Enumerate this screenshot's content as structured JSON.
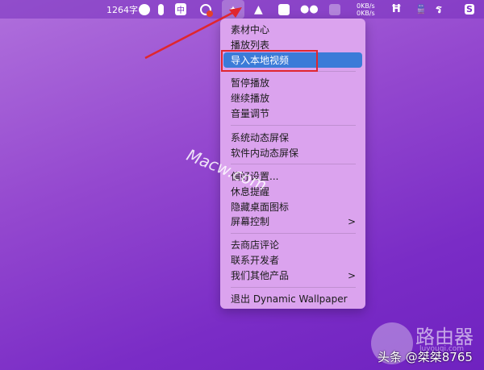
{
  "menubar": {
    "word_count": "1264字",
    "ime": "中",
    "net_up": "0KB/s",
    "net_down": "0KB/s",
    "icons": [
      "smiley-icon",
      "microphone-icon",
      "ime-icon",
      "creative-cloud-icon",
      "dynamic-wallpaper-icon",
      "dog-icon",
      "bookmark-icon",
      "wechat-icon",
      "cat-icon",
      "network-speed-icon",
      "tool-icon",
      "train-icon",
      "handwriting-icon",
      "s-app-icon"
    ]
  },
  "menu": {
    "items": [
      {
        "label": "素材中心"
      },
      {
        "label": "播放列表"
      },
      {
        "label": "导入本地视频",
        "highlighted": true
      },
      {
        "label": "暂停播放"
      },
      {
        "label": "继续播放"
      },
      {
        "label": "音量调节"
      },
      {
        "label": "系统动态屏保"
      },
      {
        "label": "软件内动态屏保"
      },
      {
        "label": "偏好设置..."
      },
      {
        "label": "休息提醒"
      },
      {
        "label": "隐藏桌面图标"
      },
      {
        "label": "屏幕控制",
        "submenu": true
      },
      {
        "label": "去商店评论"
      },
      {
        "label": "联系开发者"
      },
      {
        "label": "我们其他产品",
        "submenu": true
      },
      {
        "label": "退出 Dynamic Wallpaper"
      }
    ],
    "chevron": ">"
  },
  "watermarks": {
    "macw": "Macw.com",
    "site": "路由器",
    "site_url": "luyouqi.com",
    "author": "头条 @桀桀8765"
  },
  "colors": {
    "highlight": "#3b7bd8",
    "annotation": "#e0262e"
  }
}
